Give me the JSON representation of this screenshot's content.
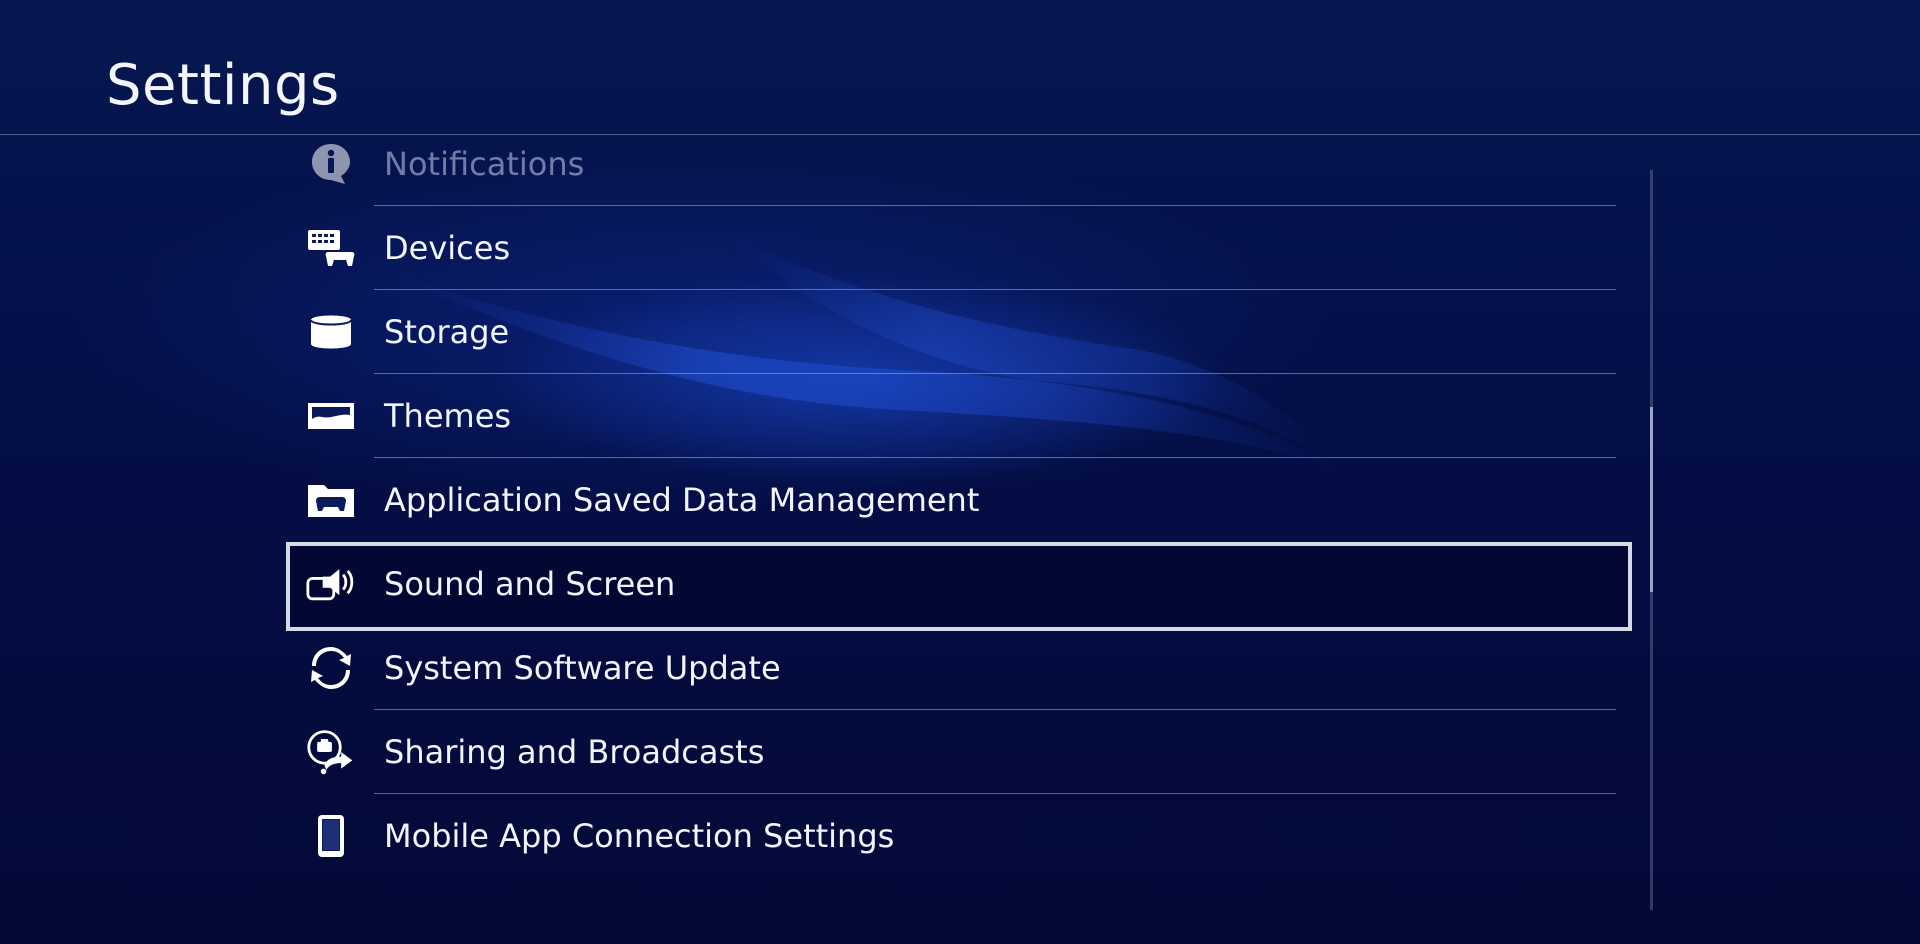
{
  "header": {
    "title": "Settings"
  },
  "settings_list": {
    "items": [
      {
        "label": "Notifications",
        "icon": "notifications-icon",
        "state": "dimmed"
      },
      {
        "label": "Devices",
        "icon": "devices-icon",
        "state": "normal"
      },
      {
        "label": "Storage",
        "icon": "storage-icon",
        "state": "normal"
      },
      {
        "label": "Themes",
        "icon": "themes-icon",
        "state": "normal"
      },
      {
        "label": "Application Saved Data Management",
        "icon": "saved-data-icon",
        "state": "normal"
      },
      {
        "label": "Sound and Screen",
        "icon": "sound-screen-icon",
        "state": "selected"
      },
      {
        "label": "System Software Update",
        "icon": "update-icon",
        "state": "normal"
      },
      {
        "label": "Sharing and Broadcasts",
        "icon": "sharing-icon",
        "state": "normal"
      },
      {
        "label": "Mobile App Connection Settings",
        "icon": "mobile-icon",
        "state": "normal"
      }
    ]
  },
  "scrollbar": {
    "visible_start_fraction": 0.32,
    "visible_end_fraction": 0.57
  },
  "colors": {
    "background": "#040c3f",
    "focus_border": "#d6d9e6",
    "text": "#f2f4ff"
  }
}
